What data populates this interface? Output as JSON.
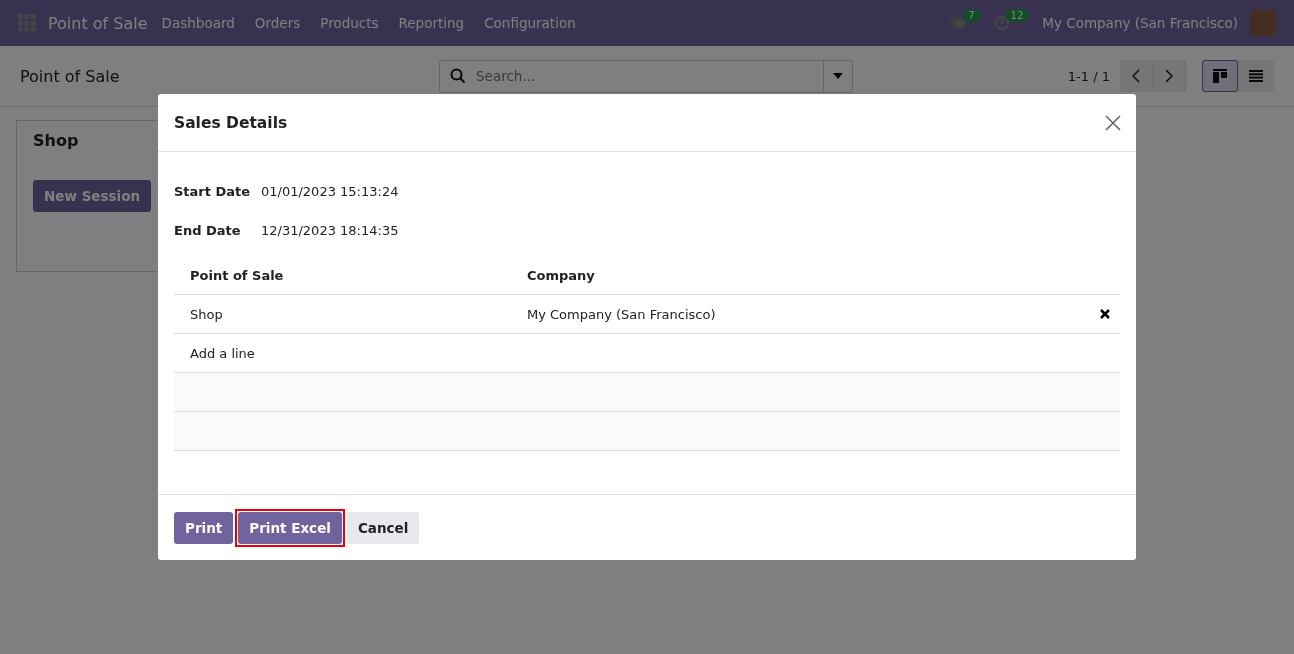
{
  "navbar": {
    "app_name": "Point of Sale",
    "menu": [
      "Dashboard",
      "Orders",
      "Products",
      "Reporting",
      "Configuration"
    ],
    "messages_count": "7",
    "activities_count": "12",
    "company": "My Company (San Francisco)"
  },
  "control_panel": {
    "breadcrumb": "Point of Sale",
    "search": {
      "placeholder": "Search..."
    },
    "pager": "1-1 / 1",
    "views": [
      {
        "kind": "kanban",
        "selected": true
      },
      {
        "kind": "list",
        "selected": false
      }
    ]
  },
  "kanban_card": {
    "title": "Shop",
    "button": "New Session"
  },
  "dialog": {
    "title": "Sales Details",
    "fields": [
      {
        "label": "Start Date",
        "value": "01/01/2023 15:13:24"
      },
      {
        "label": "End Date",
        "value": "12/31/2023 18:14:35"
      }
    ],
    "table": {
      "columns": [
        "Point of Sale",
        "Company"
      ],
      "rows": [
        {
          "point_of_sale": "Shop",
          "company": "My Company (San Francisco)"
        }
      ],
      "add_line": "Add a line"
    },
    "buttons": [
      {
        "label": "Print",
        "kind": "primary",
        "highlighted": false
      },
      {
        "label": "Print Excel",
        "kind": "primary",
        "highlighted": true
      },
      {
        "label": "Cancel",
        "kind": "secondary",
        "highlighted": false
      }
    ]
  }
}
